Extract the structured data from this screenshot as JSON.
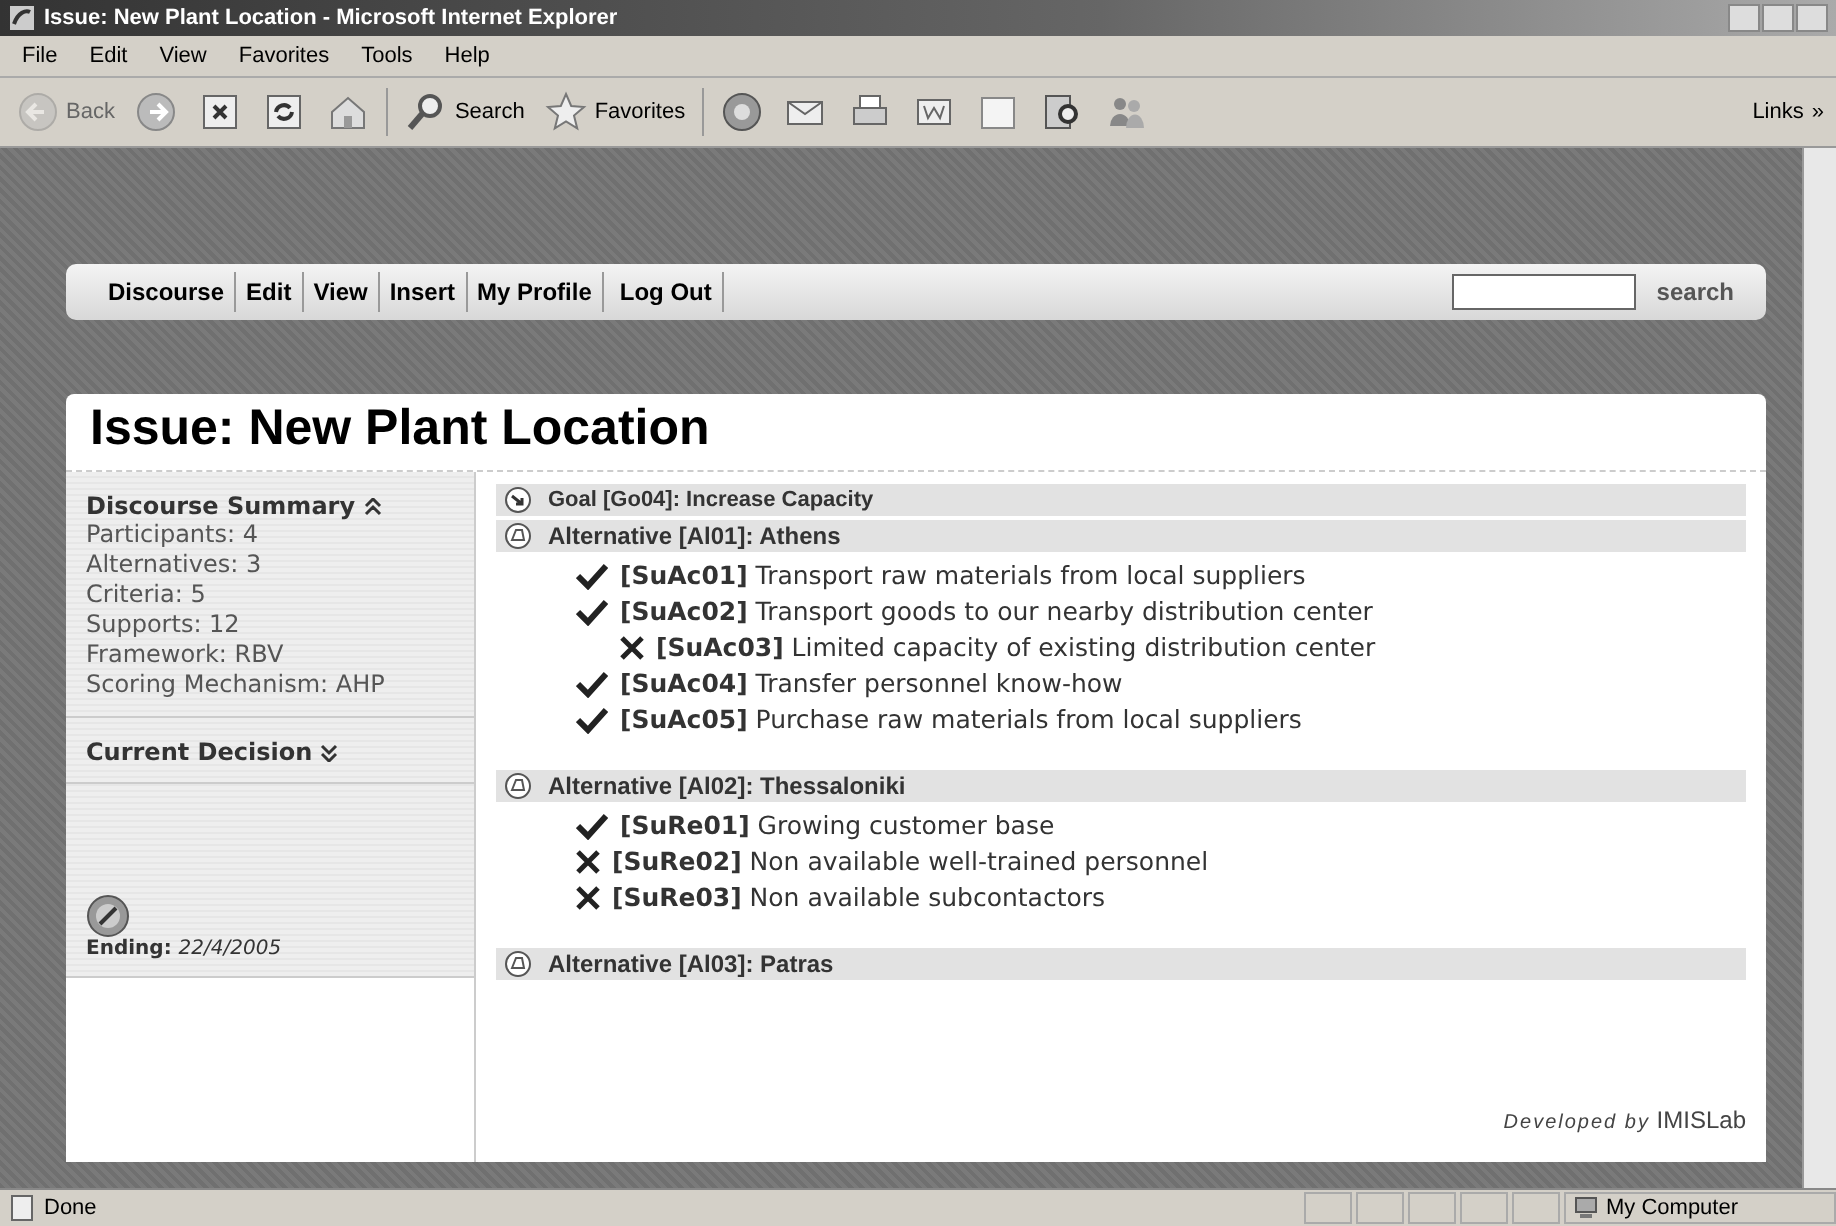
{
  "window": {
    "title": "Issue: New Plant Location - Microsoft Internet Explorer"
  },
  "menu": [
    "File",
    "Edit",
    "View",
    "Favorites",
    "Tools",
    "Help"
  ],
  "toolbar": [
    {
      "kind": "back",
      "label": "Back",
      "disabled": true
    },
    {
      "kind": "forward"
    },
    {
      "kind": "stop"
    },
    {
      "kind": "refresh"
    },
    {
      "kind": "home"
    },
    {
      "kind": "search",
      "label": "Search"
    },
    {
      "kind": "favorites",
      "label": "Favorites"
    },
    {
      "kind": "media"
    },
    {
      "kind": "mail"
    },
    {
      "kind": "print"
    },
    {
      "kind": "word"
    },
    {
      "kind": "note"
    },
    {
      "kind": "research"
    },
    {
      "kind": "messenger"
    }
  ],
  "links": {
    "label": "Links",
    "more": "»"
  },
  "nav": {
    "items": [
      "Discourse",
      "Edit",
      "View",
      "Insert",
      "My Profile",
      "Log Out"
    ],
    "search_button": "search"
  },
  "page_title": "Issue: New Plant Location",
  "summary": {
    "heading": "Discourse Summary",
    "expanded": true,
    "lines": [
      "Participants: 4",
      "Alternatives: 3",
      "Criteria: 5",
      "Supports: 12",
      "Framework: RBV",
      "Scoring Mechanism: AHP"
    ]
  },
  "decision": {
    "heading": "Current Decision",
    "expanded": false
  },
  "ending": {
    "label": "Ending:",
    "date": "22/4/2005"
  },
  "goal": {
    "label": "Goal [Go04]: Increase Capacity"
  },
  "alternatives": [
    {
      "label": "Alternative [Al01]: Athens",
      "arguments": [
        {
          "kind": "support",
          "text": "**[SuAc01]** Transport raw materials from local suppliers"
        },
        {
          "kind": "support",
          "text": "**[SuAc02]** Transport goods to our nearby distribution center",
          "children": [
            {
              "kind": "objection",
              "text": "**[SuAc03]** Limited capacity of existing distribution center"
            }
          ]
        },
        {
          "kind": "support",
          "text": "**[SuAc04]** Transfer personnel know-how"
        },
        {
          "kind": "support",
          "text": "**[SuAc05]** Purchase raw materials from local suppliers"
        }
      ]
    },
    {
      "label": "Alternative [Al02]: Thessaloniki",
      "arguments": [
        {
          "kind": "support",
          "text": "**[SuRe01]** Growing customer base"
        },
        {
          "kind": "objection",
          "text": "**[SuRe02]** Non available well-trained personnel"
        },
        {
          "kind": "objection",
          "text": "**[SuRe03]** Non available subcontactors"
        }
      ]
    },
    {
      "label": "Alternative [Al03]: Patras"
    }
  ],
  "credit": {
    "prefix": "Developed by",
    "name": "IMISLab"
  },
  "status": {
    "text": "Done",
    "zone": "My Computer"
  }
}
